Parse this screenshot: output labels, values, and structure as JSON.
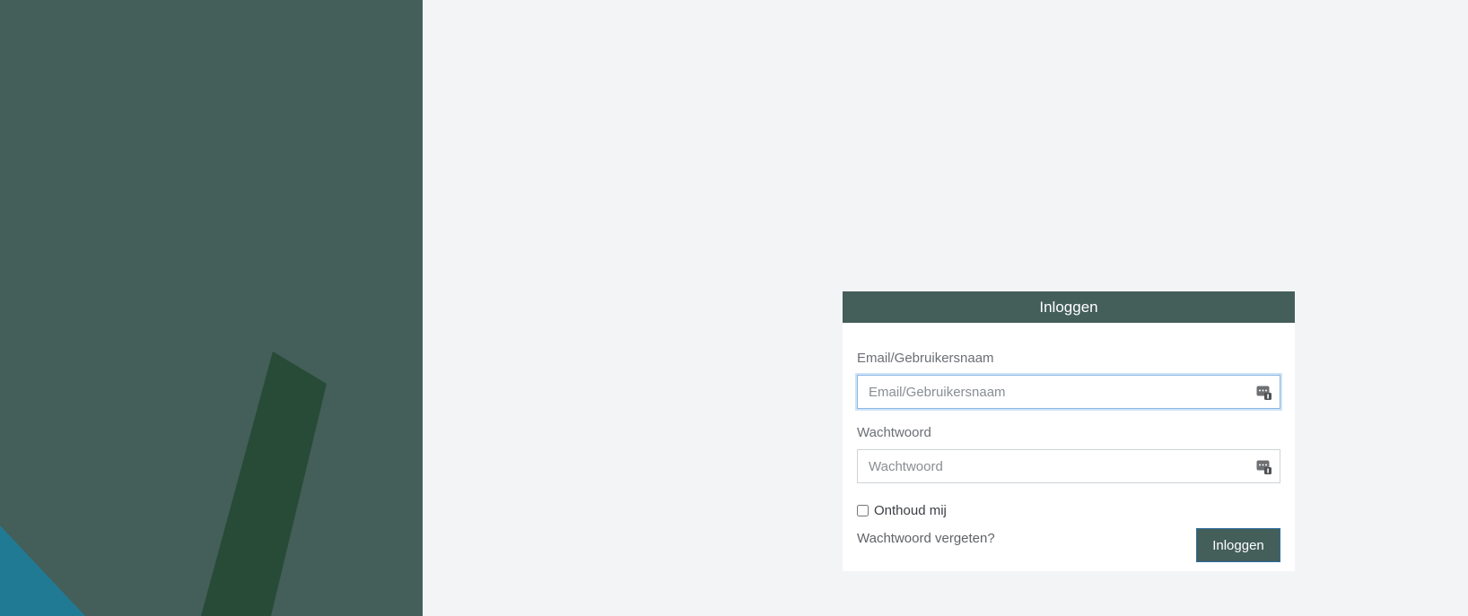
{
  "login": {
    "title": "Inloggen",
    "username_label": "Email/Gebruikersnaam",
    "username_placeholder": "Email/Gebruikersnaam",
    "username_value": "",
    "password_label": "Wachtwoord",
    "password_placeholder": "Wachtwoord",
    "password_value": "",
    "remember_label": "Onthoud mij",
    "forgot_link": "Wachtwoord vergeten?",
    "submit_label": "Inloggen"
  },
  "icons": {
    "username_field": "password-manager-icon",
    "password_field": "password-manager-icon"
  },
  "colors": {
    "brand": "#445e59",
    "background": "#f3f4f6",
    "accent_shape_dark": "#284b37",
    "accent_shape_blue": "#217a94"
  }
}
